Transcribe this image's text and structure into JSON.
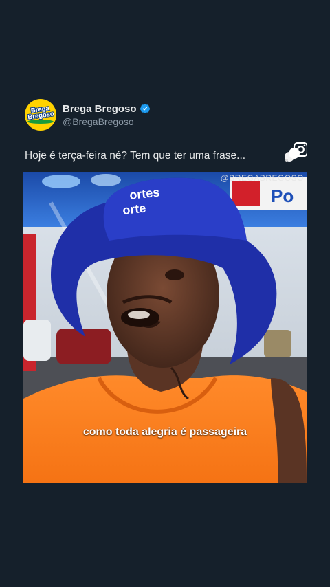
{
  "account": {
    "display_name": "Brega Bregoso",
    "handle": "@BregaBregoso",
    "avatar_logo_line1": "Brega",
    "avatar_logo_line2": "Bregoso"
  },
  "tweet": {
    "text": "Hoje é terça-feira né? Tem que ter uma frase..."
  },
  "media": {
    "watermark": "@BREGABREGOSO",
    "caption": "como toda alegria é passageira",
    "hat_text_line1": "ortes",
    "hat_text_line2": "orte",
    "sign_text": "Po"
  },
  "colors": {
    "background": "#15202b",
    "text": "#e7e9ea",
    "handle": "#8b98a5",
    "verified": "#1d9bf0"
  }
}
